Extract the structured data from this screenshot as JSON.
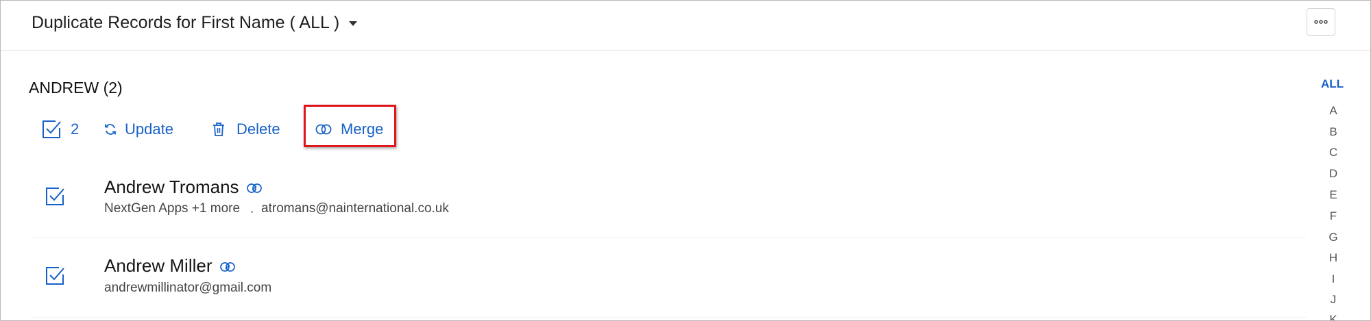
{
  "header": {
    "title": "Duplicate Records for First Name ( ALL )"
  },
  "group": {
    "title": "ANDREW (2)"
  },
  "toolbar": {
    "selected_count": "2",
    "update_label": "Update",
    "delete_label": "Delete",
    "merge_label": "Merge"
  },
  "records": [
    {
      "name": "Andrew Tromans",
      "company": "NextGen Apps +1 more",
      "email": "atromans@nainternational.co.uk"
    },
    {
      "name": "Andrew Miller",
      "email": "andrewmillinator@gmail.com"
    }
  ],
  "alphabet": {
    "all_label": "ALL",
    "letters": [
      "A",
      "B",
      "C",
      "D",
      "E",
      "F",
      "G",
      "H",
      "I",
      "J",
      "K"
    ]
  },
  "colors": {
    "accent": "#1761c9",
    "highlight": "#e0141b"
  }
}
